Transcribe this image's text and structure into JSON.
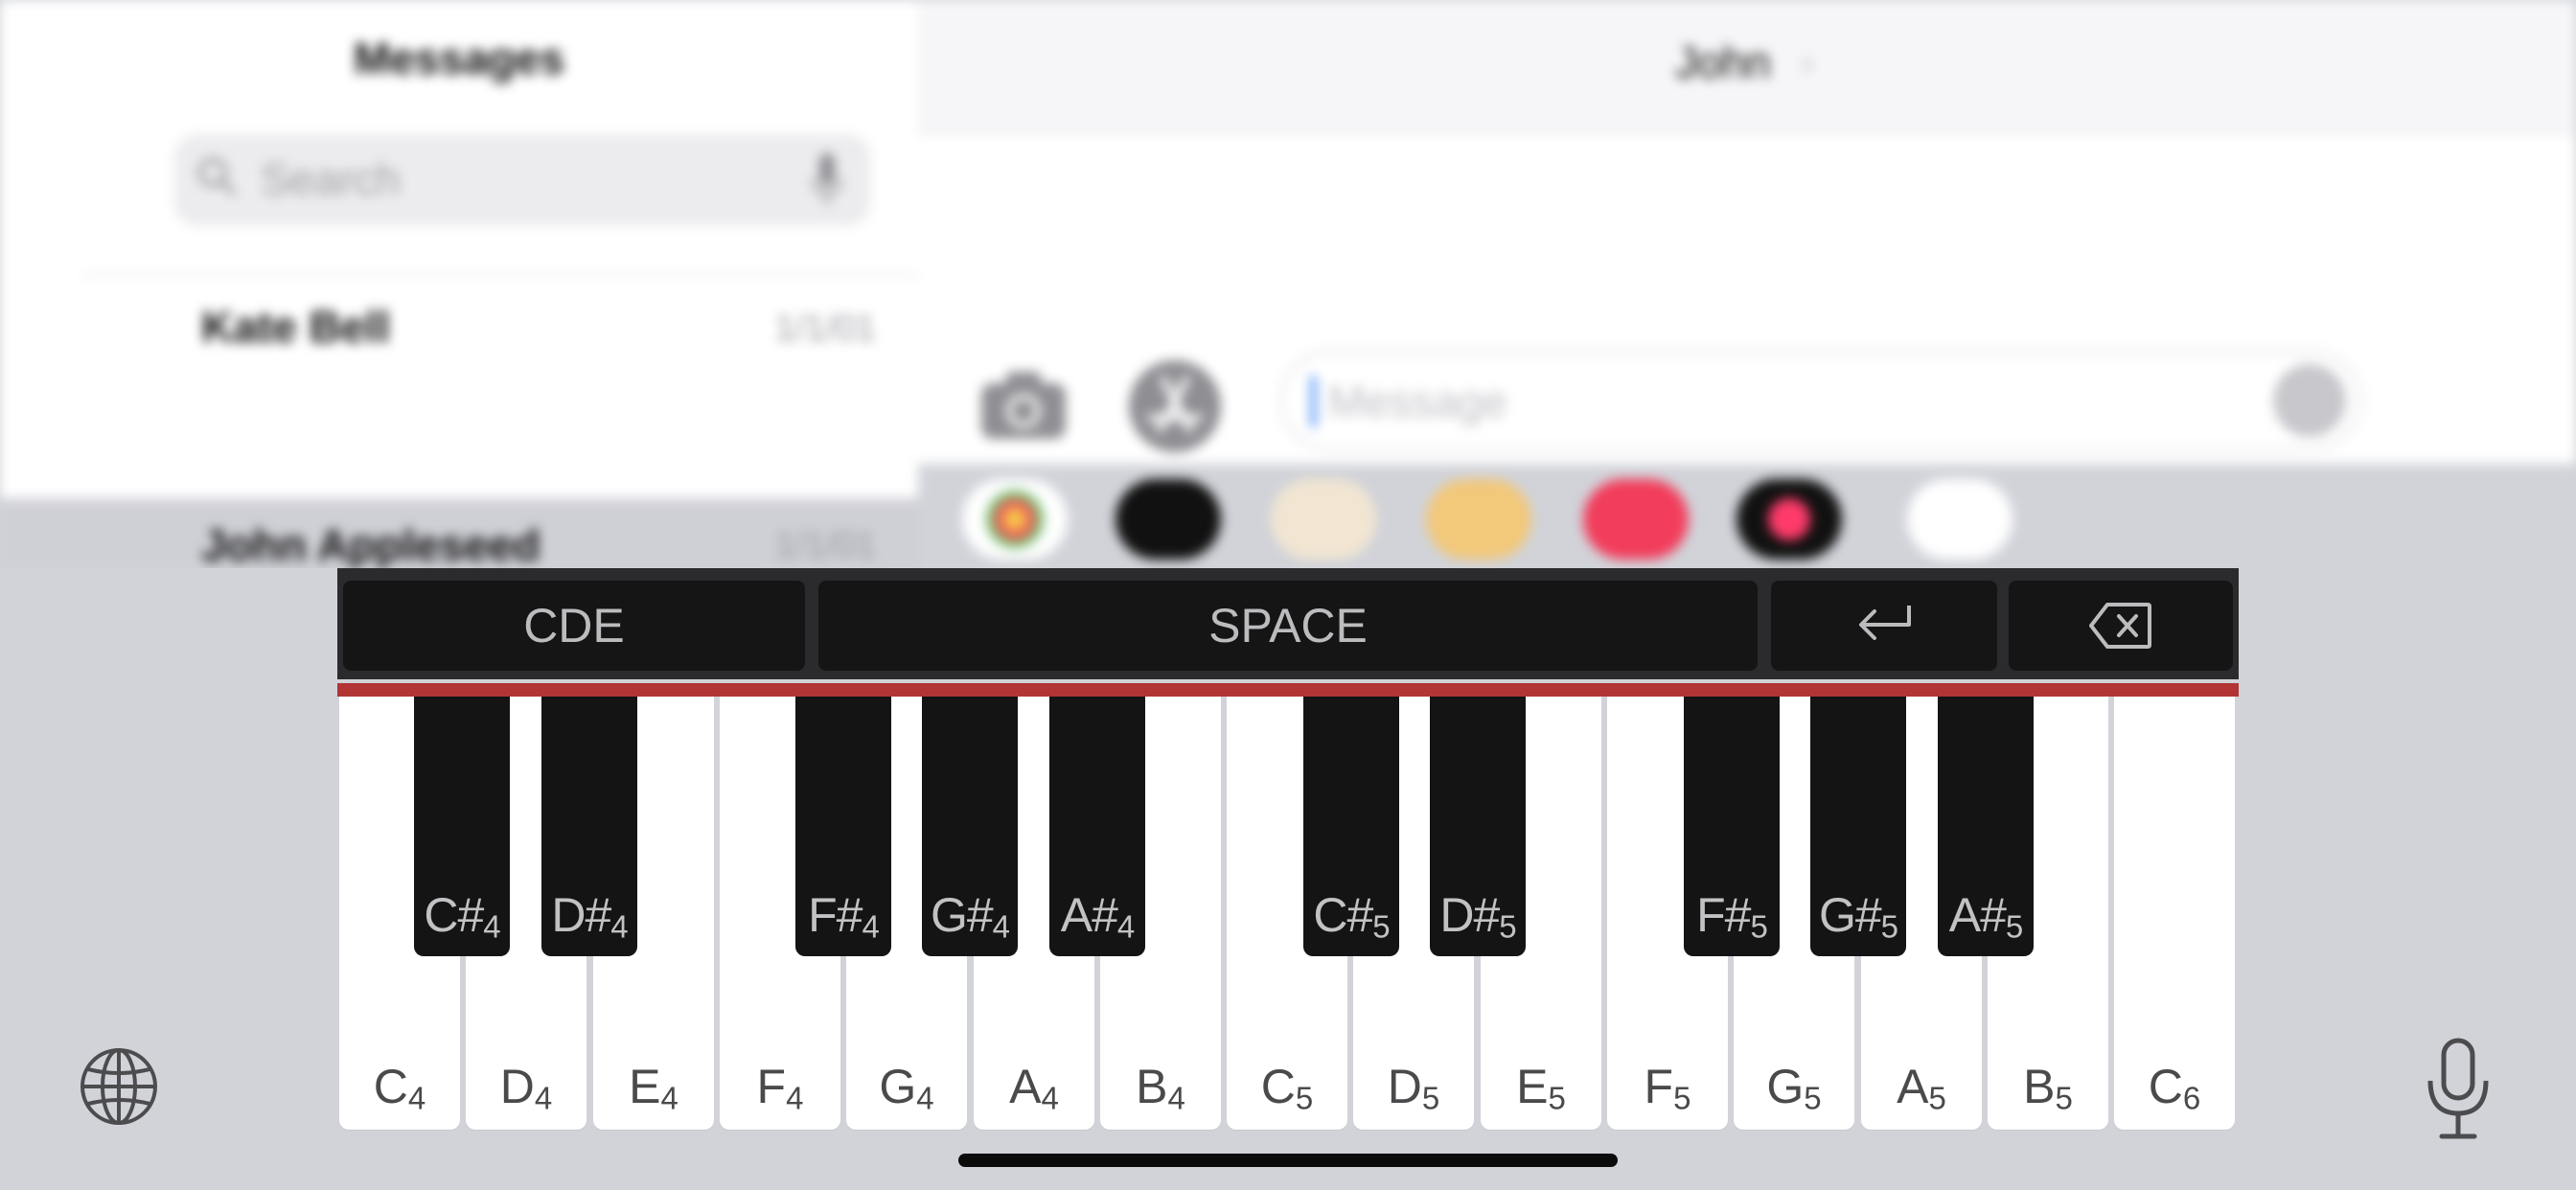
{
  "messages_list": {
    "title": "Messages",
    "search_placeholder": "Search",
    "conversations": [
      {
        "name": "Kate Bell",
        "date": "1/1/01"
      },
      {
        "name": "John Appleseed",
        "date": "1/1/01"
      }
    ]
  },
  "conversation": {
    "contact_name": "John",
    "chevron": "›",
    "message_placeholder": "Message"
  },
  "app_drawer": [
    {
      "name": "photos",
      "color": "#ffffff"
    },
    {
      "name": "apple-pay",
      "color": "#111111"
    },
    {
      "name": "memoji",
      "color": "#e8d0a8"
    },
    {
      "name": "animoji",
      "color": "#f0c070"
    },
    {
      "name": "image-search",
      "color": "#f23d5c"
    },
    {
      "name": "digital-touch",
      "color": "#111111"
    },
    {
      "name": "more",
      "color": "#ffffff"
    }
  ],
  "keyboard": {
    "controls": {
      "chord_label": "CDE",
      "space_label": "SPACE",
      "return_icon": "return-icon",
      "delete_icon": "delete-icon"
    },
    "white_keys": [
      {
        "note": "C",
        "octave": "4"
      },
      {
        "note": "D",
        "octave": "4"
      },
      {
        "note": "E",
        "octave": "4"
      },
      {
        "note": "F",
        "octave": "4"
      },
      {
        "note": "G",
        "octave": "4"
      },
      {
        "note": "A",
        "octave": "4"
      },
      {
        "note": "B",
        "octave": "4"
      },
      {
        "note": "C",
        "octave": "5"
      },
      {
        "note": "D",
        "octave": "5"
      },
      {
        "note": "E",
        "octave": "5"
      },
      {
        "note": "F",
        "octave": "5"
      },
      {
        "note": "G",
        "octave": "5"
      },
      {
        "note": "A",
        "octave": "5"
      },
      {
        "note": "B",
        "octave": "5"
      },
      {
        "note": "C",
        "octave": "6"
      }
    ],
    "black_keys": [
      {
        "note": "C#",
        "octave": "4"
      },
      {
        "note": "D#",
        "octave": "4"
      },
      {
        "note": "F#",
        "octave": "4"
      },
      {
        "note": "G#",
        "octave": "4"
      },
      {
        "note": "A#",
        "octave": "4"
      },
      {
        "note": "C#",
        "octave": "5"
      },
      {
        "note": "D#",
        "octave": "5"
      },
      {
        "note": "F#",
        "octave": "5"
      },
      {
        "note": "G#",
        "octave": "5"
      },
      {
        "note": "A#",
        "octave": "5"
      }
    ],
    "accent_color": "#b23435"
  }
}
